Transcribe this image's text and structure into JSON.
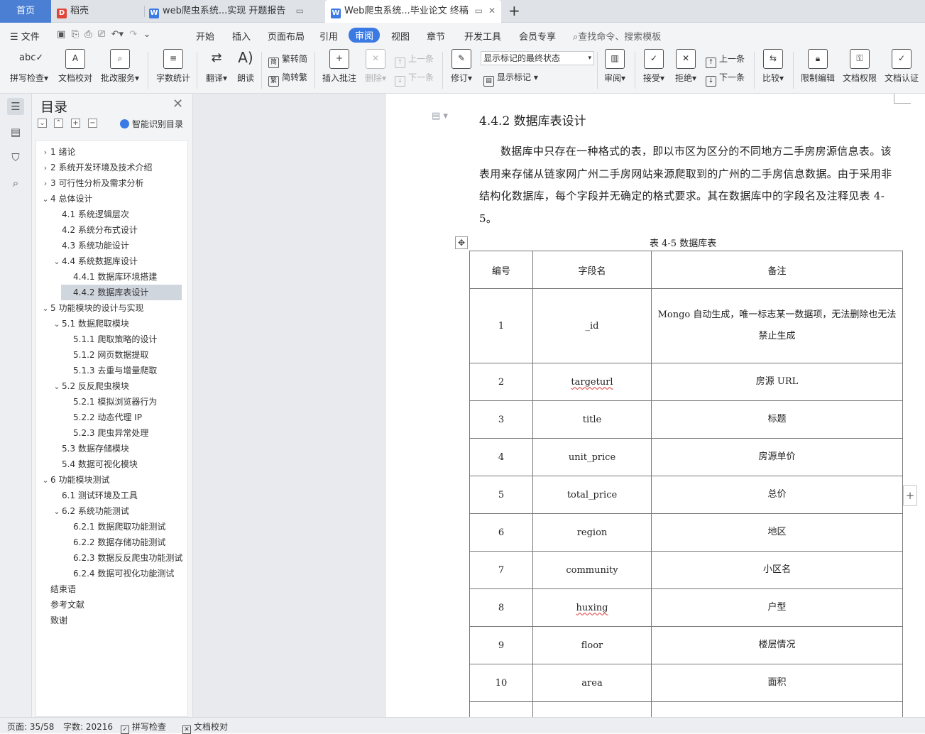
{
  "tabs": [
    {
      "label": "首页"
    },
    {
      "label": "稻壳"
    },
    {
      "label": "web爬虫系统...实现 开题报告"
    },
    {
      "label": "Web爬虫系统...毕业论文 终稿"
    }
  ],
  "new_tab": "+",
  "menu": {
    "file": "文件",
    "items": [
      "开始",
      "插入",
      "页面布局",
      "引用",
      "审阅",
      "视图",
      "章节",
      "开发工具",
      "会员专享"
    ],
    "search": "查找命令、搜索模板"
  },
  "ribbon": {
    "spell_check": "拼写检查",
    "doc_proof": "文档校对",
    "batch_service": "批改服务",
    "word_count": "字数统计",
    "translate": "翻译",
    "read_aloud": "朗读",
    "trad_to_simp": "繁转简",
    "simp_to_trad": "简转繁",
    "insert_comment": "插入批注",
    "delete": "删除",
    "prev_comment": "上一条",
    "next_comment": "下一条",
    "revise": "修订",
    "markup_state": "显示标记的最终状态",
    "show_markup": "显示标记",
    "review": "审阅",
    "accept": "接受",
    "reject": "拒绝",
    "prev_change": "上一条",
    "next_change": "下一条",
    "compare": "比较",
    "restrict_edit": "限制编辑",
    "doc_permission": "文档权限",
    "doc_auth": "文档认证"
  },
  "toc": {
    "title": "目录",
    "smart": "智能识别目录",
    "items": [
      {
        "text": "1  绪论",
        "arrow": "›"
      },
      {
        "text": "2  系统开发环境及技术介绍",
        "arrow": "›"
      },
      {
        "text": "3  可行性分析及需求分析",
        "arrow": "›"
      },
      {
        "text": "4  总体设计",
        "arrow": "⌄"
      },
      {
        "text": "4.1  系统逻辑层次",
        "arrow": ""
      },
      {
        "text": "4.2  系统分布式设计",
        "arrow": ""
      },
      {
        "text": "4.3  系统功能设计",
        "arrow": ""
      },
      {
        "text": "4.4  系统数据库设计",
        "arrow": "⌄"
      },
      {
        "text": "4.4.1  数据库环境搭建",
        "arrow": ""
      },
      {
        "text": "4.4.2  数据库表设计",
        "arrow": ""
      },
      {
        "text": "5  功能模块的设计与实现",
        "arrow": "⌄"
      },
      {
        "text": "5.1  数据爬取模块",
        "arrow": "⌄"
      },
      {
        "text": "5.1.1  爬取策略的设计",
        "arrow": ""
      },
      {
        "text": "5.1.2  网页数据提取",
        "arrow": ""
      },
      {
        "text": "5.1.3  去重与增量爬取",
        "arrow": ""
      },
      {
        "text": "5.2  反反爬虫模块",
        "arrow": "⌄"
      },
      {
        "text": "5.2.1  模拟浏览器行为",
        "arrow": ""
      },
      {
        "text": "5.2.2  动态代理 IP",
        "arrow": ""
      },
      {
        "text": "5.2.3  爬虫异常处理",
        "arrow": ""
      },
      {
        "text": "5.3  数据存储模块",
        "arrow": ""
      },
      {
        "text": "5.4  数据可视化模块",
        "arrow": ""
      },
      {
        "text": "6  功能模块测试",
        "arrow": "⌄"
      },
      {
        "text": "6.1  测试环境及工具",
        "arrow": ""
      },
      {
        "text": "6.2  系统功能测试",
        "arrow": "⌄"
      },
      {
        "text": "6.2.1  数据爬取功能测试",
        "arrow": ""
      },
      {
        "text": "6.2.2  数据存储功能测试",
        "arrow": ""
      },
      {
        "text": "6.2.3  数据反反爬虫功能测试",
        "arrow": ""
      },
      {
        "text": "6.2.4  数据可视化功能测试",
        "arrow": ""
      },
      {
        "text": "结束语",
        "arrow": ""
      },
      {
        "text": "参考文献",
        "arrow": ""
      },
      {
        "text": "致谢",
        "arrow": ""
      }
    ]
  },
  "doc": {
    "heading": "4.4.2  数据库表设计",
    "paragraph": "数据库中只存在一种格式的表，即以市区为区分的不同地方二手房房源信息表。该表用来存储从链家网广州二手房网站来源爬取到的广州的二手房信息数据。由于采用非结构化数据库，每个字段并无确定的格式要求。其在数据库中的字段名及注释见表 4-5。",
    "caption": "表 4-5 数据库表",
    "table": {
      "headers": [
        "编号",
        "字段名",
        "备注"
      ],
      "rows": [
        [
          "1",
          "_id",
          "Mongo 自动生成，唯一标志某一数据项，无法删除也无法禁止生成"
        ],
        [
          "2",
          "targeturl",
          "房源 URL"
        ],
        [
          "3",
          "title",
          "标题"
        ],
        [
          "4",
          "unit_price",
          "房源单价"
        ],
        [
          "5",
          "total_price",
          "总价"
        ],
        [
          "6",
          "region",
          "地区"
        ],
        [
          "7",
          "community",
          "小区名"
        ],
        [
          "8",
          "huxing",
          "户型"
        ],
        [
          "9",
          "floor",
          "楼层情况"
        ],
        [
          "10",
          "area",
          "面积"
        ],
        [
          "",
          "",
          ""
        ]
      ]
    }
  },
  "status": {
    "page": "页面: 35/58",
    "words": "字数: 20216",
    "spell": "拼写检查",
    "proof": "文档校对"
  }
}
